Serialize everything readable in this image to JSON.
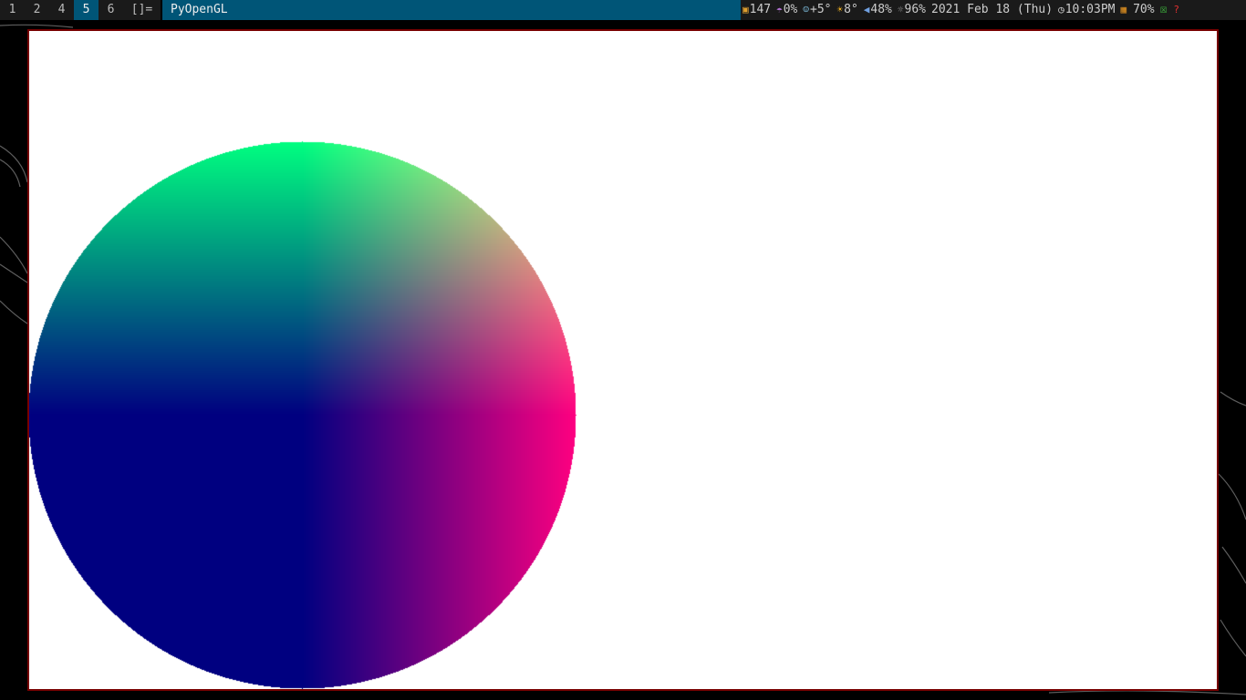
{
  "bar": {
    "tags": [
      "1",
      "2",
      "4",
      "5",
      "6"
    ],
    "active_tag": "5",
    "layout_symbol": "[]=",
    "window_title": "PyOpenGL",
    "status": {
      "packages": "147",
      "rain": "0%",
      "temp_feel": "+5°",
      "temp": "8°",
      "volume": "48%",
      "brightness": "96%",
      "date": "2021 Feb 18 (Thu)",
      "time": "10:03PM",
      "wifi": "70%"
    },
    "icons": {
      "packages": "package-icon",
      "rain": "umbrella-icon",
      "temp_feel": "weather-face-icon",
      "temp": "sun-icon",
      "volume": "speaker-icon",
      "brightness": "brightness-icon",
      "time": "clock-icon",
      "wifi": "wifi-signal-icon",
      "status_ok": "checkmark-box-icon",
      "help": "question-icon"
    }
  },
  "colors": {
    "bar_accent": "#005577",
    "window_border": "#770000",
    "canvas_bg": "#ffffff",
    "gradient_top": "#00ff80",
    "gradient_right": "#ff0080",
    "gradient_center": "#000080"
  }
}
